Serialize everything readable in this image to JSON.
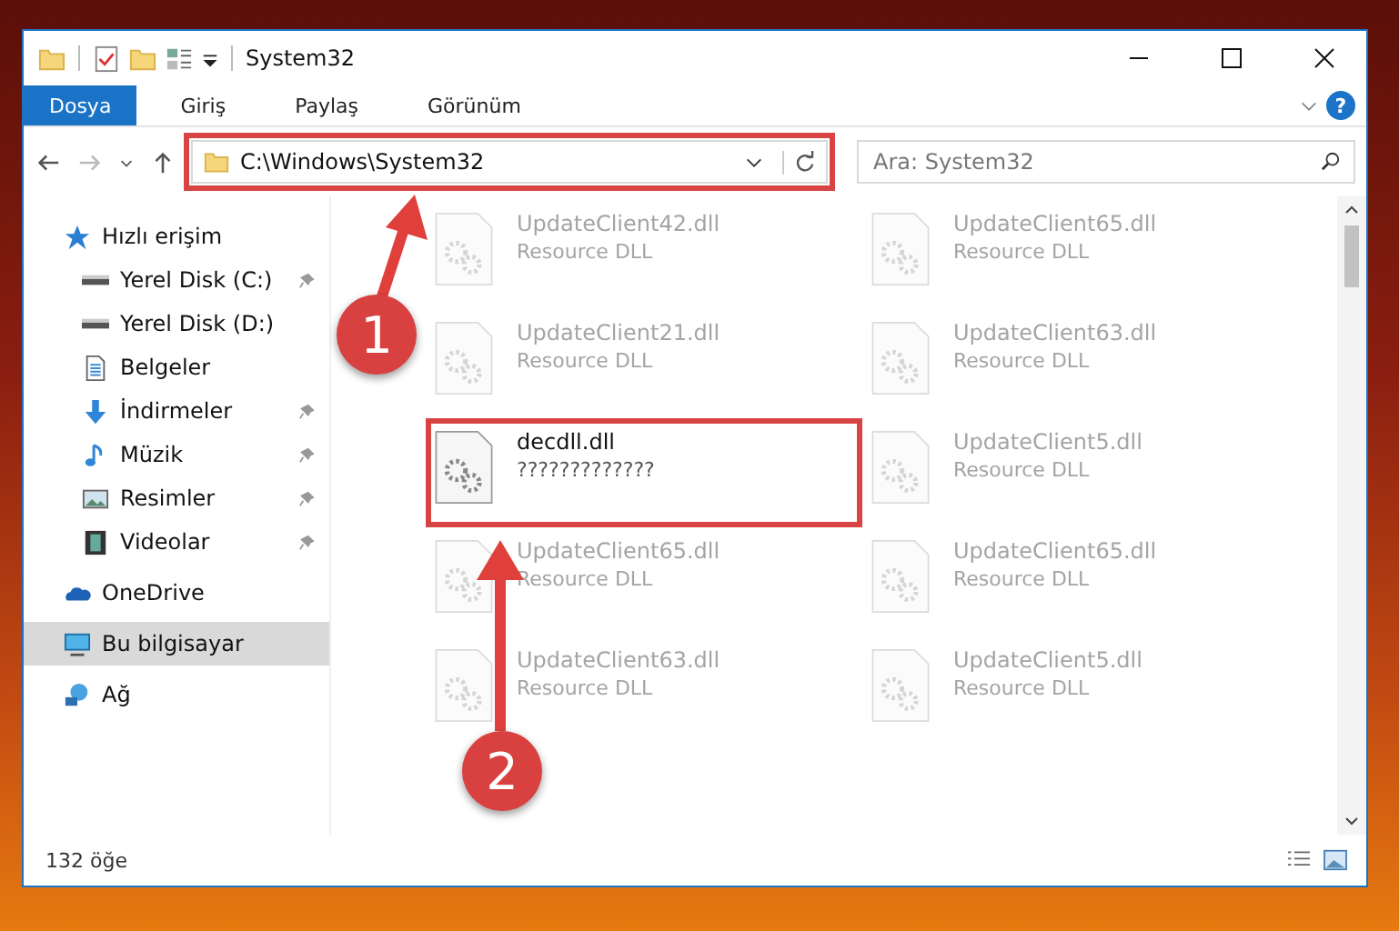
{
  "window": {
    "title": "System32"
  },
  "ribbon_tabs": [
    {
      "label": "Dosya",
      "selected": true
    },
    {
      "label": "Giriş",
      "selected": false
    },
    {
      "label": "Paylaş",
      "selected": false
    },
    {
      "label": "Görünüm",
      "selected": false
    }
  ],
  "help_button": "?",
  "address_bar": {
    "path": "C:\\Windows\\System32",
    "annotated": true
  },
  "search": {
    "placeholder": "Ara: System32"
  },
  "sidebar": {
    "items": [
      {
        "label": "Hızlı erişim",
        "kind": "star",
        "selected": false,
        "children": [
          {
            "label": "Yerel Disk (C:)",
            "kind": "drive",
            "pinned": true,
            "selected": false
          },
          {
            "label": "Yerel Disk (D:)",
            "kind": "drive",
            "pinned": false,
            "selected": false
          },
          {
            "label": "Belgeler",
            "kind": "doc",
            "pinned": false,
            "selected": false
          },
          {
            "label": "İndirmeler",
            "kind": "download",
            "pinned": true,
            "selected": false
          },
          {
            "label": "Müzik",
            "kind": "music",
            "pinned": true,
            "selected": false
          },
          {
            "label": "Resimler",
            "kind": "picture",
            "pinned": true,
            "selected": false
          },
          {
            "label": "Videolar",
            "kind": "video",
            "pinned": true,
            "selected": false
          }
        ]
      },
      {
        "label": "OneDrive",
        "kind": "cloud",
        "selected": false
      },
      {
        "label": "Bu bilgisayar",
        "kind": "computer",
        "selected": true
      },
      {
        "label": "Ağ",
        "kind": "network",
        "selected": false
      }
    ]
  },
  "files": [
    {
      "name": "UpdateClient42.dll",
      "type": "Resource DLL",
      "dimmed": true,
      "annotated": false
    },
    {
      "name": "UpdateClient65.dll",
      "type": "Resource DLL",
      "dimmed": true,
      "annotated": false
    },
    {
      "name": "UpdateClient21.dll",
      "type": "Resource DLL",
      "dimmed": true,
      "annotated": false
    },
    {
      "name": "UpdateClient63.dll",
      "type": "Resource DLL",
      "dimmed": true,
      "annotated": false
    },
    {
      "name": "decdll.dll",
      "type": "?????????????",
      "dimmed": false,
      "annotated": true
    },
    {
      "name": "UpdateClient5.dll",
      "type": "Resource DLL",
      "dimmed": true,
      "annotated": false
    },
    {
      "name": "UpdateClient65.dll",
      "type": "Resource DLL",
      "dimmed": true,
      "annotated": false
    },
    {
      "name": "UpdateClient65.dll",
      "type": "Resource DLL",
      "dimmed": true,
      "annotated": false
    },
    {
      "name": "UpdateClient63.dll",
      "type": "Resource DLL",
      "dimmed": true,
      "annotated": false
    },
    {
      "name": "UpdateClient5.dll",
      "type": "Resource DLL",
      "dimmed": true,
      "annotated": false
    }
  ],
  "status_bar": {
    "count": "132 öğe"
  },
  "callouts": [
    {
      "number": "1"
    },
    {
      "number": "2"
    }
  ]
}
